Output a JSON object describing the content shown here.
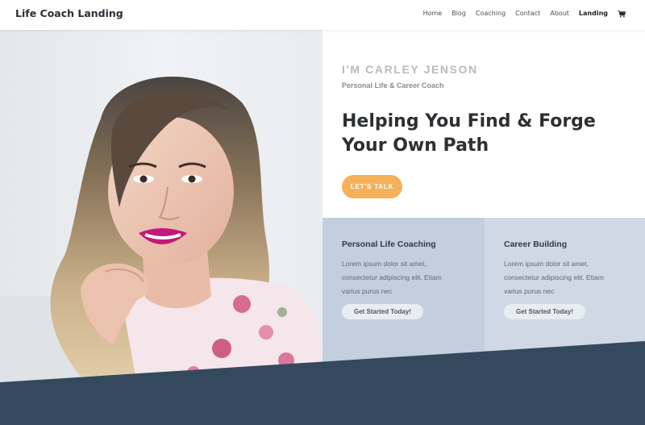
{
  "site": {
    "title": "Life Coach Landing"
  },
  "nav": {
    "items": [
      {
        "label": "Home"
      },
      {
        "label": "Blog"
      },
      {
        "label": "Coaching"
      },
      {
        "label": "Contact"
      },
      {
        "label": "About"
      },
      {
        "label": "Landing"
      }
    ],
    "cart_icon": "shopping-cart-icon"
  },
  "hero": {
    "photo_icon": "portrait-photo",
    "name": "I'M CARLEY JENSON",
    "role": "Personal Life & Career Coach",
    "headline_line1": "Helping You Find & Forge",
    "headline_line2": "Your Own Path",
    "cta_label": "LET'S TALK"
  },
  "services": [
    {
      "title": "Personal Life Coaching",
      "text_line1": "Lorem ipsum dolor sit amet,",
      "text_line2": "consectetur adipiscing elit. Etiam",
      "text_line3": "varius purus nec",
      "button": "Get Started Today!"
    },
    {
      "title": "Career Building",
      "text_line1": "Lorem ipsum dolor sit amet,",
      "text_line2": "consectetur adipiscing elit. Etiam",
      "text_line3": "varius purus nec",
      "button": "Get Started Today!"
    }
  ],
  "colors": {
    "accent": "#f5b15a",
    "card1": "#c3cfdd",
    "card2": "#cfd8e4",
    "bottom_band": "#34495e"
  }
}
